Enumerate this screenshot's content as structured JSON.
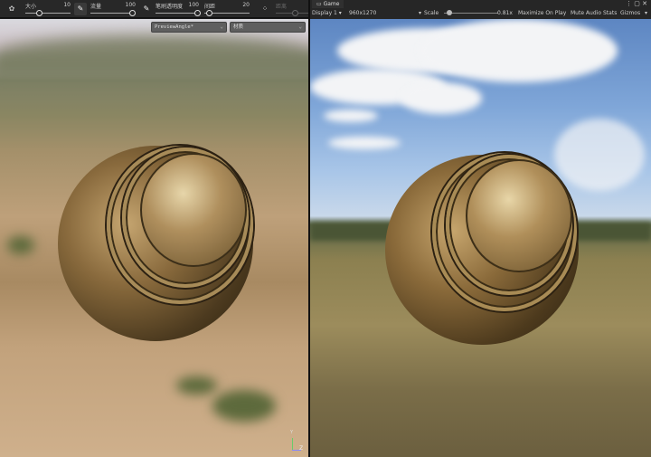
{
  "brush_toolbar": {
    "size": {
      "label": "大小",
      "value": "10"
    },
    "flow": {
      "label": "流量",
      "value": "100"
    },
    "opacity": {
      "label": "笔刷透明度",
      "value": "100"
    },
    "spacing": {
      "label": "间距",
      "value": "20"
    },
    "scatter": {
      "label": "距离"
    }
  },
  "scene_view": {
    "preview_dropdown": "PreviewAngle*",
    "material_dropdown": "材质",
    "gizmo": {
      "y": "Y",
      "z": "Z"
    }
  },
  "game_view": {
    "tab_label": "Game",
    "display": "Display 1",
    "resolution": "960x1270",
    "scale_label": "Scale",
    "scale_value": "0.81x",
    "scale_fraction": 0.1,
    "maximize": "Maximize On Play",
    "mute": "Mute Audio",
    "stats": "Stats",
    "gizmos": "Gizmos"
  }
}
